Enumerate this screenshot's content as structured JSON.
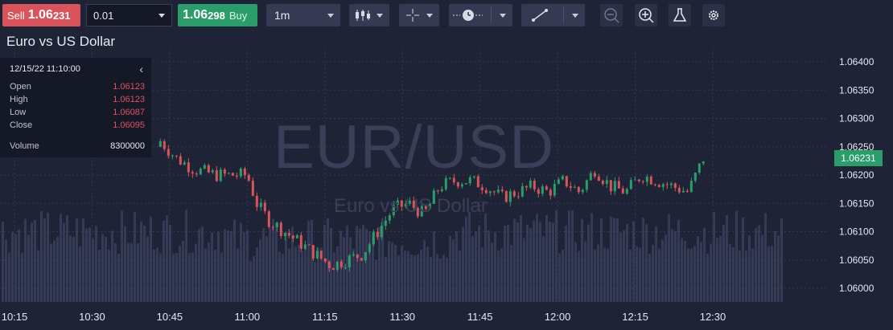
{
  "toolbar": {
    "sell": {
      "label": "Sell",
      "price_main": "1.06",
      "price_pips": "231"
    },
    "quantity": {
      "value": "0.01"
    },
    "buy": {
      "price_main": "1.06",
      "price_pips": "298",
      "label": "Buy"
    },
    "timeframe": {
      "value": "1m"
    },
    "icons": [
      "candlestick-chart-icon",
      "crosshair-icon",
      "clock-icon",
      "line-draw-icon",
      "zoom-out-icon",
      "zoom-in-icon",
      "flask-icon",
      "gear-icon"
    ]
  },
  "chart": {
    "title": "Euro vs US Dollar",
    "watermark_symbol": "EUR/USD",
    "watermark_name": "Euro vs US Dollar",
    "current_price": "1.06231",
    "colors": {
      "up": "#2a9d6a",
      "down": "#d9535c",
      "volume": "#3e4462",
      "background": "#1f2336"
    }
  },
  "info_panel": {
    "datetime": "12/15/22 11:10:00",
    "open_label": "Open",
    "open": "1.06123",
    "high_label": "High",
    "high": "1.06123",
    "low_label": "Low",
    "low": "1.06087",
    "close_label": "Close",
    "close": "1.06095",
    "volume_label": "Volume",
    "volume": "8300000"
  },
  "chart_data": {
    "type": "candlestick",
    "x_ticks": [
      "10:15",
      "10:30",
      "10:45",
      "11:00",
      "11:15",
      "11:30",
      "11:45",
      "12:00",
      "12:15",
      "12:30"
    ],
    "y_ticks": [
      "1.06400",
      "1.06350",
      "1.06300",
      "1.06250",
      "1.06200",
      "1.06150",
      "1.06100",
      "1.06050",
      "1.06000"
    ],
    "ylim": [
      1.0598,
      1.0643
    ],
    "close_path": [
      [
        10.72,
        1.0626
      ],
      [
        10.77,
        1.0623
      ],
      [
        10.83,
        1.0621
      ],
      [
        10.9,
        1.062
      ],
      [
        10.95,
        1.062
      ],
      [
        11.0,
        1.062
      ],
      [
        11.03,
        1.0615
      ],
      [
        11.07,
        1.0612
      ],
      [
        11.12,
        1.061
      ],
      [
        11.17,
        1.0608
      ],
      [
        11.22,
        1.0606
      ],
      [
        11.27,
        1.0604
      ],
      [
        11.32,
        1.0605
      ],
      [
        11.37,
        1.0606
      ],
      [
        11.42,
        1.061
      ],
      [
        11.47,
        1.0614
      ],
      [
        11.52,
        1.0615
      ],
      [
        11.57,
        1.0613
      ],
      [
        11.62,
        1.0618
      ],
      [
        11.67,
        1.0619
      ],
      [
        11.72,
        1.0619
      ],
      [
        11.77,
        1.0618
      ],
      [
        11.82,
        1.0616
      ],
      [
        11.87,
        1.0617
      ],
      [
        11.92,
        1.0618
      ],
      [
        11.97,
        1.0617
      ],
      [
        12.02,
        1.0619
      ],
      [
        12.07,
        1.0617
      ],
      [
        12.12,
        1.0621
      ],
      [
        12.17,
        1.0618
      ],
      [
        12.22,
        1.0617
      ],
      [
        12.27,
        1.062
      ],
      [
        12.32,
        1.0619
      ],
      [
        12.37,
        1.0618
      ],
      [
        12.42,
        1.0617
      ],
      [
        12.47,
        1.0623
      ]
    ]
  }
}
